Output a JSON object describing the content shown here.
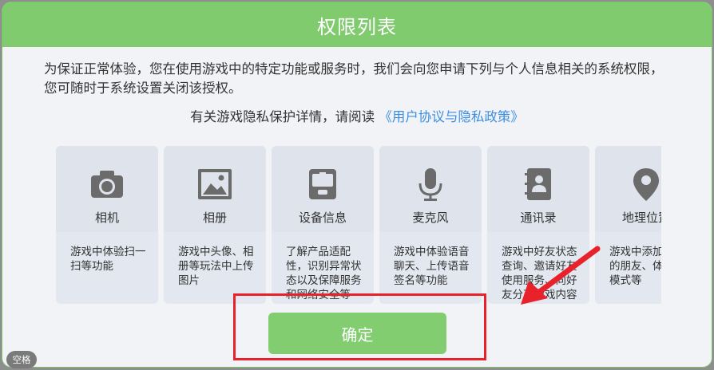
{
  "dialog": {
    "title": "权限列表",
    "intro": "为保证正常体验，您在使用游戏中的特定功能或服务时，我们会向您申请下列与个人信息相关的系统权限，您可随时于系统设置关闭该授权。",
    "privacy_prefix": "有关游戏隐私保护详情，请阅读",
    "privacy_link": "《用户协议与隐私政策》",
    "confirm_label": "确定"
  },
  "permissions": [
    {
      "icon": "camera-icon",
      "name": "相机",
      "desc": "游戏中体验扫一扫等功能"
    },
    {
      "icon": "image-icon",
      "name": "相册",
      "desc": "游戏中头像、相册等玩法中上传图片"
    },
    {
      "icon": "device-info-icon",
      "name": "设备信息",
      "desc": "了解产品适配性，识别异常状态以及保障服务和网络安全等"
    },
    {
      "icon": "microphone-icon",
      "name": "麦克风",
      "desc": "游戏中体验语音聊天、上传语音签名等功能"
    },
    {
      "icon": "contacts-icon",
      "name": "通讯录",
      "desc": "游戏中好友状态查询、邀请好友使用服务、向好友分享游戏内容"
    },
    {
      "icon": "location-pin-icon",
      "name": "地理位置",
      "desc": "游戏中添加附近的朋友、体验魔模式等"
    }
  ],
  "overlay": {
    "space_key_label": "空格"
  },
  "colors": {
    "accent_green": "#7fcb6e",
    "link_blue": "#3c8fe0",
    "annotation_red": "#e8212b",
    "icon_gray": "#6b6b6b"
  }
}
